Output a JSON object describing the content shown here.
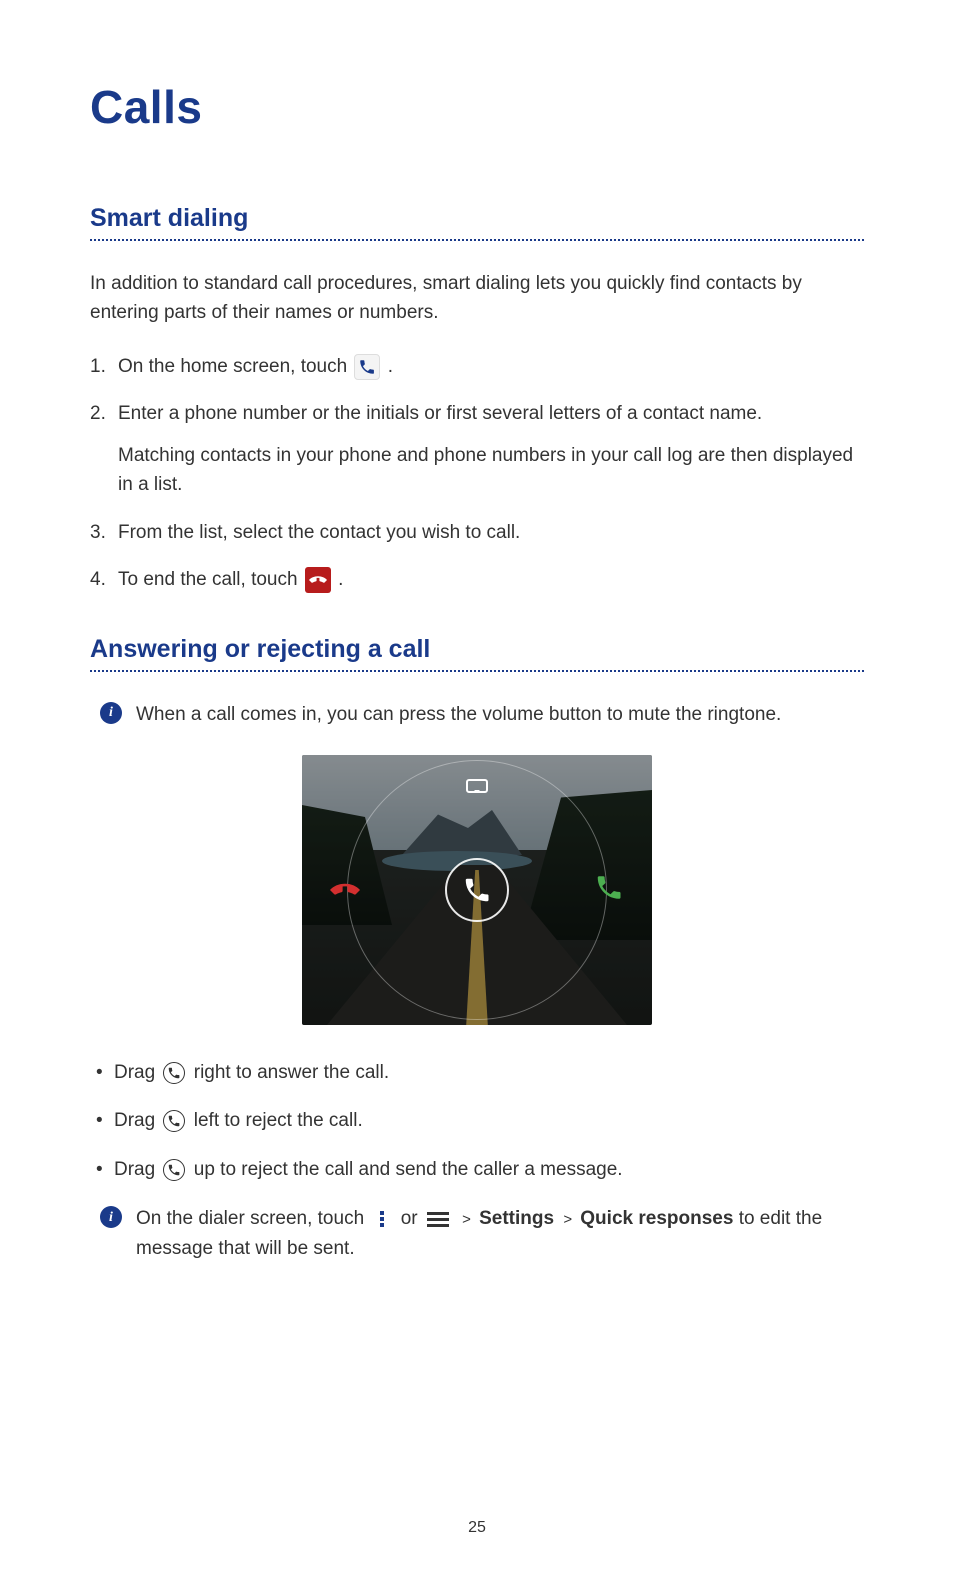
{
  "page_number": "25",
  "title": "Calls",
  "smart_dialing": {
    "heading": "Smart dialing",
    "intro": "In addition to standard call procedures, smart dialing lets you quickly find contacts by entering parts of their names or numbers.",
    "step1": "On the home screen, touch ",
    "step1_end": ".",
    "step2_a": "Enter a phone number or the initials or first several letters of a contact name.",
    "step2_b": "Matching contacts in your phone and phone numbers in your call log are then displayed in a list.",
    "step3": "From the list, select the contact you wish to call.",
    "step4": "To end the call, touch ",
    "step4_end": "."
  },
  "answering": {
    "heading": "Answering or rejecting a call",
    "note1": "When a call comes in, you can press the volume button to mute the ringtone.",
    "bullet_pre": "Drag ",
    "bullet1_post": "right to answer the call.",
    "bullet2_post": "left to reject the call.",
    "bullet3_post": "up to reject the call and send the caller a message.",
    "note2_a": "On the dialer screen, touch ",
    "note2_or": " or ",
    "note2_gt": " > ",
    "note2_settings": "Settings",
    "note2_quick": "Quick responses",
    "note2_end": " to edit the message that will be sent."
  },
  "info_badge": "i"
}
